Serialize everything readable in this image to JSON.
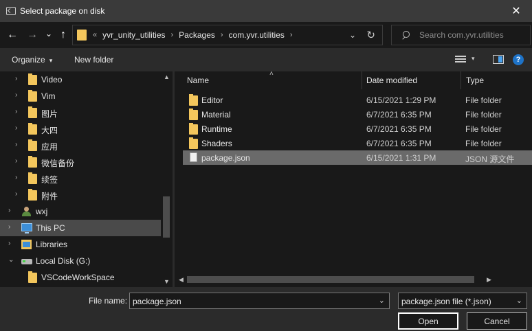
{
  "window": {
    "title": "Select package on disk",
    "close_glyph": "✕"
  },
  "nav": {
    "back": "←",
    "forward": "→",
    "recent": "⌄",
    "up": "↑"
  },
  "address": {
    "overflow": "«",
    "segments": [
      "yvr_unity_utilities",
      "Packages",
      "com.yvr.utilities"
    ],
    "sep": "›",
    "dropdown": "⌄",
    "refresh": "↻"
  },
  "search": {
    "placeholder": "Search com.yvr.utilities"
  },
  "toolbar": {
    "organize": "Organize",
    "organize_caret": "▾",
    "new_folder": "New folder",
    "view_caret": "▾",
    "help": "?"
  },
  "tree": [
    {
      "label": "Video",
      "icon": "folder-icon",
      "arrow": "›",
      "selected": false
    },
    {
      "label": "Vim",
      "icon": "folder-icon",
      "arrow": "›",
      "selected": false
    },
    {
      "label": "图片",
      "icon": "folder-icon",
      "arrow": "›",
      "selected": false
    },
    {
      "label": "大四",
      "icon": "folder-icon",
      "arrow": "›",
      "selected": false
    },
    {
      "label": "应用",
      "icon": "folder-icon",
      "arrow": "›",
      "selected": false
    },
    {
      "label": "微信备份",
      "icon": "folder-icon",
      "arrow": "›",
      "selected": false
    },
    {
      "label": "续签",
      "icon": "folder-icon",
      "arrow": "›",
      "selected": false
    },
    {
      "label": "附件",
      "icon": "folder-icon",
      "arrow": "›",
      "selected": false
    },
    {
      "label": "wxj",
      "icon": "user-icon",
      "arrow": "›",
      "selected": false
    },
    {
      "label": "This PC",
      "icon": "pc-icon",
      "arrow": "›",
      "selected": true
    },
    {
      "label": "Libraries",
      "icon": "library-icon",
      "arrow": "›",
      "selected": false
    },
    {
      "label": "Local Disk (G:)",
      "icon": "drive-icon",
      "arrow": "⌄",
      "selected": false
    },
    {
      "label": "VSCodeWorkSpace",
      "icon": "folder-icon",
      "arrow": "",
      "selected": false
    }
  ],
  "scroll": {
    "up": "▲",
    "down": "▼",
    "left": "◀",
    "right": "▶"
  },
  "columns": {
    "name": "Name",
    "date": "Date modified",
    "type": "Type",
    "sort_caret": "˄"
  },
  "files": [
    {
      "name": "Editor",
      "date": "6/15/2021 1:29 PM",
      "type": "File folder",
      "icon": "folder-icon",
      "selected": false
    },
    {
      "name": "Material",
      "date": "6/7/2021 6:35 PM",
      "type": "File folder",
      "icon": "folder-icon",
      "selected": false
    },
    {
      "name": "Runtime",
      "date": "6/7/2021 6:35 PM",
      "type": "File folder",
      "icon": "folder-icon",
      "selected": false
    },
    {
      "name": "Shaders",
      "date": "6/7/2021 6:35 PM",
      "type": "File folder",
      "icon": "folder-icon",
      "selected": false
    },
    {
      "name": "package.json",
      "date": "6/15/2021 1:31 PM",
      "type": "JSON 源文件",
      "icon": "file-icon",
      "selected": true
    }
  ],
  "bottom": {
    "file_name_label": "File name:",
    "file_name_value": "package.json",
    "filter_value": "package.json file (*.json)",
    "dropdown": "⌄",
    "open": "Open",
    "cancel": "Cancel"
  }
}
